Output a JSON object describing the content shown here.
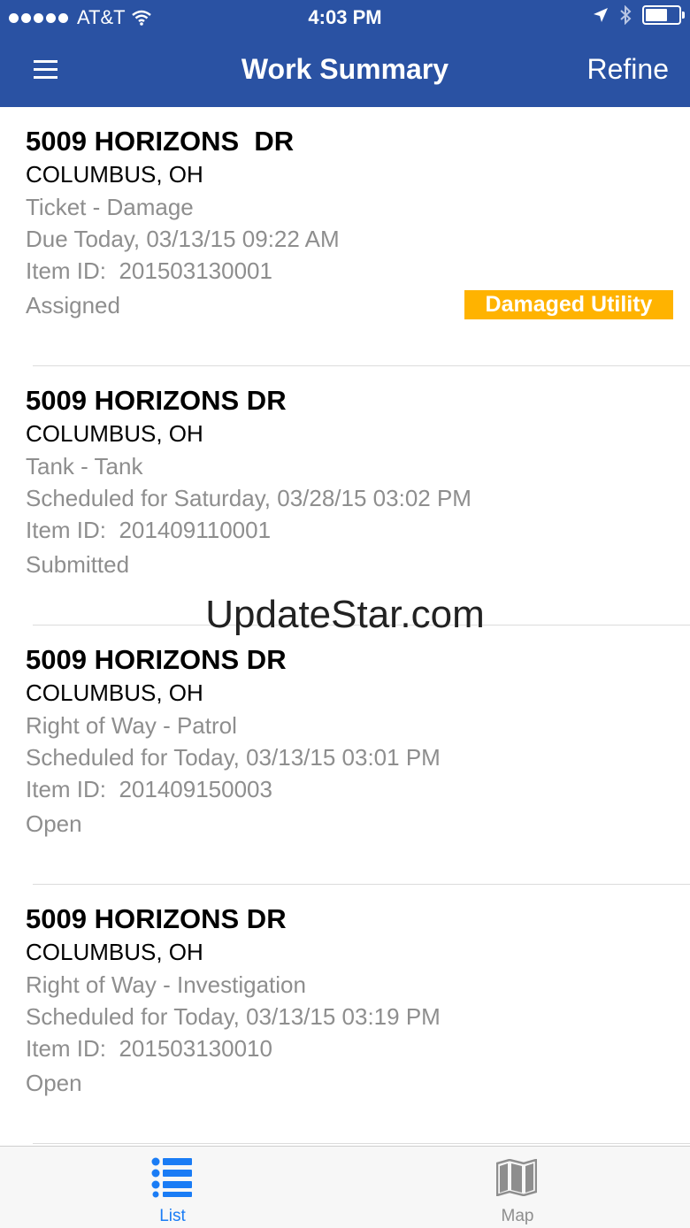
{
  "status_bar": {
    "carrier": "AT&T",
    "time": "4:03 PM",
    "icons": [
      "signal-dots-icon",
      "wifi-icon",
      "location-arrow-icon",
      "bluetooth-icon",
      "battery-icon"
    ]
  },
  "nav": {
    "title": "Work Summary",
    "refine_label": "Refine",
    "menu_icon": "hamburger-menu-icon",
    "color": "#2a52a3"
  },
  "items": [
    {
      "address": "5009 HORIZONS  DR",
      "city": "COLUMBUS, OH",
      "type": "Ticket - Damage",
      "schedule": "Due Today, 03/13/15 09:22 AM",
      "item_id": "Item ID:  201503130001",
      "status": "Assigned",
      "badge": "Damaged Utility"
    },
    {
      "address": "5009 HORIZONS DR",
      "city": "COLUMBUS, OH",
      "type": "Tank - Tank",
      "schedule": "Scheduled for Saturday, 03/28/15 03:02 PM",
      "item_id": "Item ID:  201409110001",
      "status": "Submitted"
    },
    {
      "address": "5009 HORIZONS DR",
      "city": "COLUMBUS, OH",
      "type": "Right of Way - Patrol",
      "schedule": "Scheduled for Today, 03/13/15 03:01 PM",
      "item_id": "Item ID:  201409150003",
      "status": "Open"
    },
    {
      "address": "5009 HORIZONS DR",
      "city": "COLUMBUS, OH",
      "type": "Right of Way - Investigation",
      "schedule": "Scheduled for Today, 03/13/15 03:19 PM",
      "item_id": "Item ID:  201503130010",
      "status": "Open"
    }
  ],
  "watermark": "UpdateStar.com",
  "tabs": [
    {
      "label": "List",
      "icon": "list-icon",
      "selected": true
    },
    {
      "label": "Map",
      "icon": "map-icon",
      "selected": false
    }
  ],
  "colors": {
    "accent": "#1a7cf5",
    "badge": "#ffb300",
    "secondary_text": "#8e8e8e"
  }
}
